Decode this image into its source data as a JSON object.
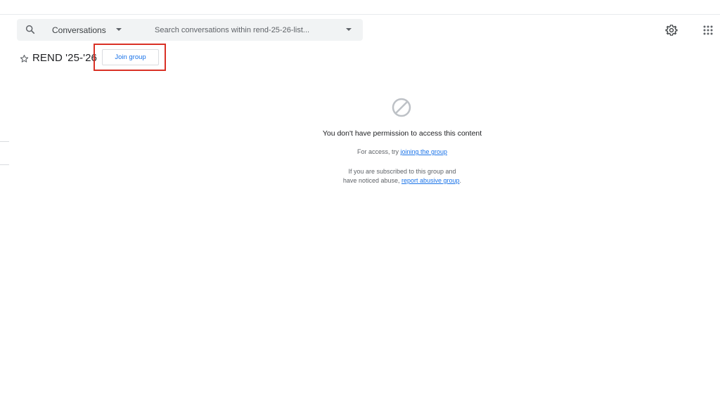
{
  "search": {
    "scope_label": "Conversations",
    "placeholder": "Search conversations within rend-25-26-list..."
  },
  "group": {
    "title": "REND '25-'26",
    "join_label": "Join group"
  },
  "message": {
    "title": "You don't have permission to access this content",
    "access_prefix": "For access, try ",
    "access_link": "joining the group",
    "abuse_line1": "If you are subscribed to this group and",
    "abuse_prefix": "have noticed abuse, ",
    "abuse_link": "report abusive group",
    "abuse_suffix": "."
  },
  "icons": {
    "search": "search-icon",
    "scope_dropdown": "chevron-down-icon",
    "search_options": "chevron-down-icon",
    "settings": "gear-icon",
    "apps": "apps-grid-icon",
    "star": "star-outline-icon",
    "blocked": "blocked-icon"
  },
  "colors": {
    "link": "#1a73e8",
    "highlight": "#d93025",
    "search_bg": "#f1f3f4"
  }
}
